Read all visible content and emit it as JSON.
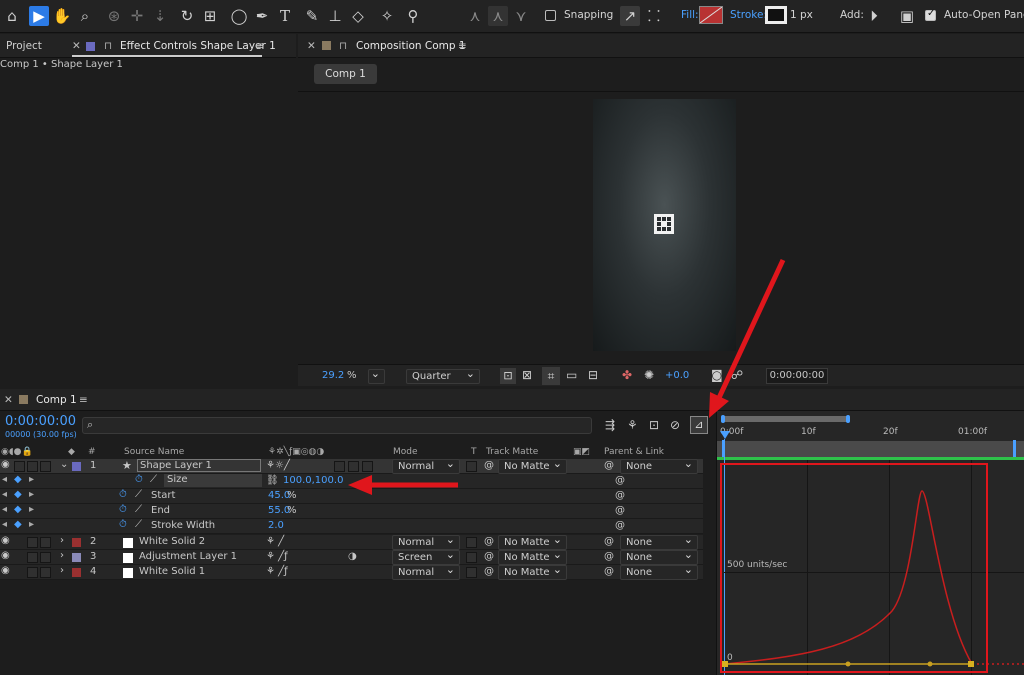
{
  "toolbar": {
    "snapping_label": "Snapping",
    "fill_label": "Fill:",
    "stroke_label": "Stroke:",
    "stroke_value": "1 px",
    "add_label": "Add:",
    "auto_open_label": "Auto-Open Panel",
    "colors": {
      "accent": "#2c7be6",
      "fill_swatch": "#b83232"
    }
  },
  "left_panel": {
    "project_tab": "Project",
    "effect_tab": "Effect Controls Shape Layer 1",
    "breadcrumb": "Comp 1 • Shape Layer 1"
  },
  "comp_panel": {
    "tab": "Composition Comp 1",
    "comp_button": "Comp 1",
    "zoom_value": "29.2",
    "zoom_unit": "%",
    "resolution": "Quarter",
    "exposure": "+0.0",
    "timecode": "0:00:00:00"
  },
  "timeline": {
    "tab": "Comp 1",
    "timecode": "0:00:00:00",
    "fps": "00000 (30.00 fps)",
    "headers": {
      "number": "#",
      "source_name": "Source Name",
      "mode": "Mode",
      "t": "T",
      "track_matte": "Track Matte",
      "parent_link": "Parent & Link"
    },
    "layers": [
      {
        "num": "1",
        "name": "Shape Layer 1",
        "mode": "Normal",
        "matte": "No Matte",
        "parent": "None",
        "label_color": "#6a6abf"
      },
      {
        "num": "2",
        "name": "White Solid 2",
        "mode": "Normal",
        "matte": "No Matte",
        "parent": "None",
        "label_color": "#9a3030"
      },
      {
        "num": "3",
        "name": "Adjustment Layer 1",
        "mode": "Screen",
        "matte": "No Matte",
        "parent": "None",
        "label_color": "#8a8ab8"
      },
      {
        "num": "4",
        "name": "White Solid 1",
        "mode": "Normal",
        "matte": "No Matte",
        "parent": "None",
        "label_color": "#9a3030"
      }
    ],
    "properties": [
      {
        "name": "Size",
        "value": "100.0,100.0",
        "unit": ""
      },
      {
        "name": "Start",
        "value": "45.0",
        "unit": "%"
      },
      {
        "name": "End",
        "value": "55.0",
        "unit": "%"
      },
      {
        "name": "Stroke Width",
        "value": "2.0",
        "unit": ""
      }
    ],
    "ruler": [
      "0:00f",
      "10f",
      "20f",
      "01:00f"
    ],
    "graph_label": "500 units/sec",
    "graph_zero": "0"
  }
}
